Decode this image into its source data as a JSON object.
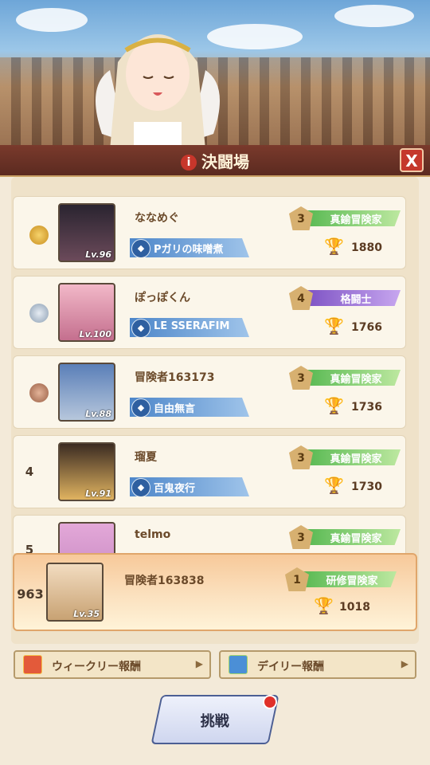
{
  "header": {
    "title": "決闘場",
    "close_label": "X"
  },
  "ranking": [
    {
      "rank": "",
      "medal": "gold-medal-icon",
      "name": "ななめぐ",
      "level": "Lv.96",
      "guild": "Pガリの味噌煮",
      "tier_level": "3",
      "tier": "真鍮冒険家",
      "tier_color": "#7fcf7a",
      "score": "1880"
    },
    {
      "rank": "",
      "medal": "silver-medal-icon",
      "name": "ぽっぽくん",
      "level": "Lv.100",
      "guild": "LE SSERAFIM",
      "tier_level": "4",
      "tier": "格闘士",
      "tier_color": "#9b6ad6",
      "score": "1766"
    },
    {
      "rank": "",
      "medal": "bronze-medal-icon",
      "name": "冒険者163173",
      "level": "Lv.88",
      "guild": "自由無言",
      "tier_level": "3",
      "tier": "真鍮冒険家",
      "tier_color": "#7fcf7a",
      "score": "1736"
    },
    {
      "rank": "4",
      "medal": "",
      "name": "瑠夏",
      "level": "Lv.91",
      "guild": "百鬼夜行",
      "tier_level": "3",
      "tier": "真鍮冒険家",
      "tier_color": "#7fcf7a",
      "score": "1730"
    },
    {
      "rank": "5",
      "medal": "",
      "name": "telmo",
      "level": "",
      "guild": "",
      "tier_level": "3",
      "tier": "真鍮冒険家",
      "tier_color": "#7fcf7a",
      "score": ""
    }
  ],
  "me": {
    "rank": "963",
    "name": "冒険者163838",
    "level": "Lv.35",
    "tier_level": "1",
    "tier": "研修冒険家",
    "tier_color": "#7fcf7a",
    "score": "1018"
  },
  "buttons": {
    "weekly": "ウィークリー報酬",
    "daily": "デイリー報酬",
    "challenge": "挑戦"
  }
}
